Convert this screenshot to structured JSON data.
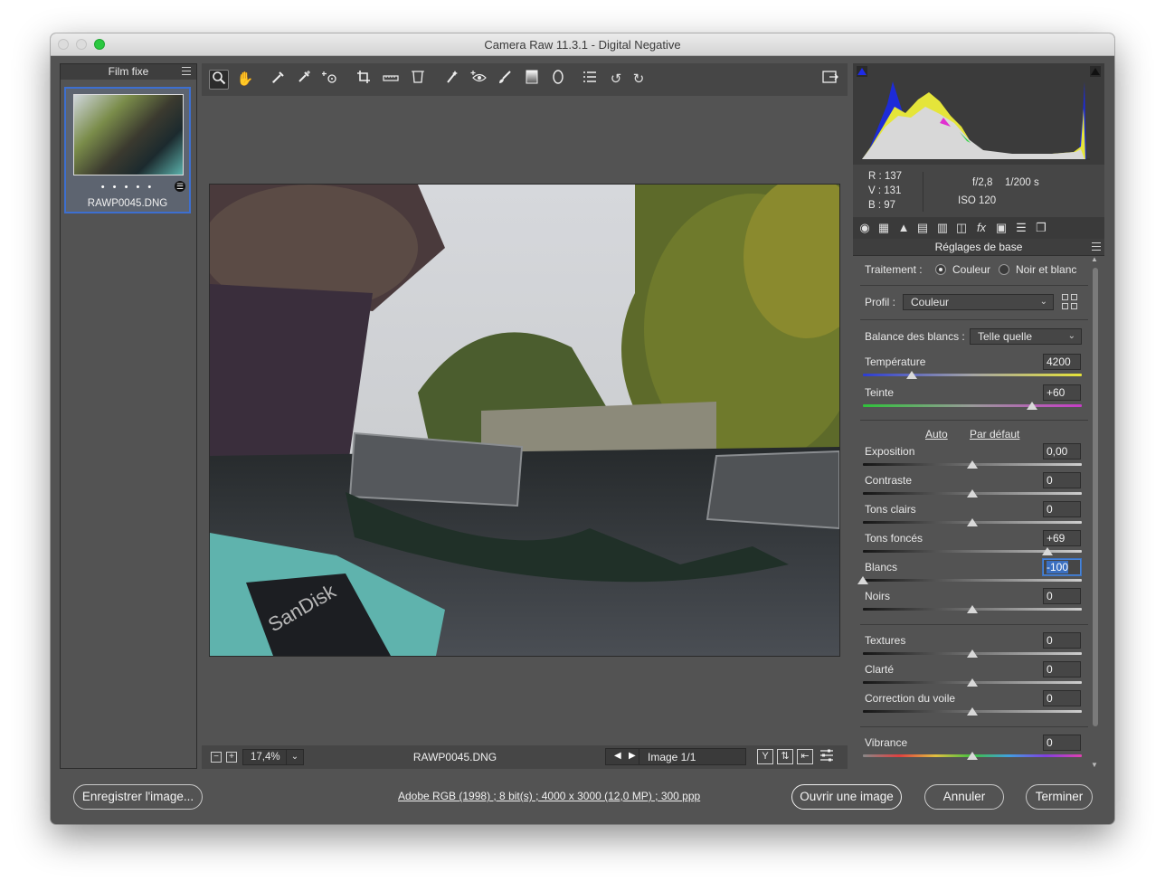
{
  "window": {
    "title": "Camera Raw 11.3.1  -  Digital Negative"
  },
  "filmstrip": {
    "title": "Film fixe",
    "thumbnail": {
      "rating_dots": "• • • • •",
      "filename": "RAWP0045.DNG"
    }
  },
  "toolbar": {
    "tools": [
      "zoom-tool",
      "hand-tool",
      "white-balance-tool",
      "color-sampler-tool",
      "target-adjustment-tool",
      "crop-tool",
      "straighten-tool",
      "transform-tool",
      "spot-removal-tool",
      "red-eye-tool",
      "adjustment-brush-tool",
      "graduated-filter-tool",
      "radial-filter-tool",
      "presets-list-tool",
      "rotate-ccw-tool",
      "rotate-cw-tool"
    ],
    "active_tool": "zoom-tool"
  },
  "preview": {
    "zoom": "17,4%",
    "filename": "RAWP0045.DNG",
    "image_counter": "Image 1/1",
    "compare_button": "Y"
  },
  "readout": {
    "r": "R :   137",
    "v": "V :   131",
    "b": "B :    97",
    "aperture": "f/2,8",
    "shutter": "1/200 s",
    "iso": "ISO 120"
  },
  "panel": {
    "title": "Réglages de base",
    "treatment_label": "Traitement :",
    "treatment_color": "Couleur",
    "treatment_bw": "Noir et blanc",
    "treatment_selected": "Couleur",
    "profile_label": "Profil :",
    "profile_value": "Couleur",
    "wb_label": "Balance des blancs :",
    "wb_value": "Telle quelle",
    "auto_link": "Auto",
    "default_link": "Par défaut",
    "sliders": {
      "temperature": {
        "label": "Température",
        "value": "4200"
      },
      "tint": {
        "label": "Teinte",
        "value": "+60"
      },
      "exposure": {
        "label": "Exposition",
        "value": "0,00"
      },
      "contrast": {
        "label": "Contraste",
        "value": "0"
      },
      "highlights": {
        "label": "Tons clairs",
        "value": "0"
      },
      "shadows": {
        "label": "Tons foncés",
        "value": "+69"
      },
      "whites": {
        "label": "Blancs",
        "value": "-100"
      },
      "blacks": {
        "label": "Noirs",
        "value": "0"
      },
      "texture": {
        "label": "Textures",
        "value": "0"
      },
      "clarity": {
        "label": "Clarté",
        "value": "0"
      },
      "dehaze": {
        "label": "Correction du voile",
        "value": "0"
      },
      "vibrance": {
        "label": "Vibrance",
        "value": "0"
      }
    }
  },
  "footer": {
    "save_button": "Enregistrer l'image...",
    "workflow_info": "Adobe RGB (1998) ; 8 bit(s) ; 4000 x 3000 (12,0 MP) ; 300 ppp",
    "open_button": "Ouvrir une image",
    "cancel_button": "Annuler",
    "done_button": "Terminer"
  },
  "colors": {
    "accent": "#3d6fd0",
    "panel_bg": "#535353",
    "toolbar_bg": "#464646",
    "traffic_green": "#2bc840"
  }
}
